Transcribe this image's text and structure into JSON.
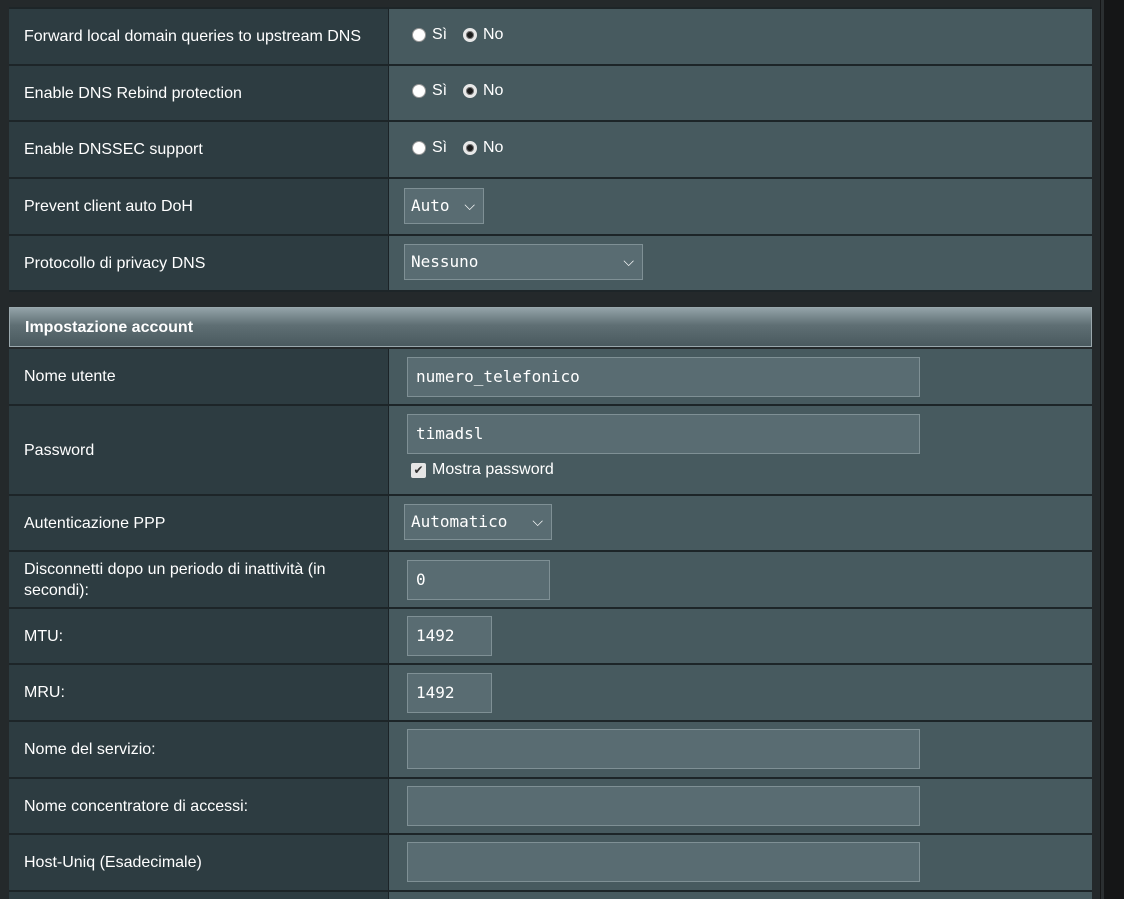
{
  "dns": {
    "forward_local": {
      "label": "Forward local domain queries to upstream DNS",
      "yes": "Sì",
      "no": "No",
      "selected": "No"
    },
    "rebind": {
      "label": "Enable DNS Rebind protection",
      "yes": "Sì",
      "no": "No",
      "selected": "No"
    },
    "dnssec": {
      "label": "Enable DNSSEC support",
      "yes": "Sì",
      "no": "No",
      "selected": "No"
    },
    "doh": {
      "label": "Prevent client auto DoH",
      "value": "Auto"
    },
    "privacy": {
      "label": "Protocollo di privacy DNS",
      "value": "Nessuno"
    }
  },
  "account": {
    "title": "Impostazione account",
    "username": {
      "label": "Nome utente",
      "value": "numero_telefonico"
    },
    "password": {
      "label": "Password",
      "value": "timadsl",
      "show_label": "Mostra password",
      "show_checked": true
    },
    "ppp_auth": {
      "label": "Autenticazione PPP",
      "value": "Automatico"
    },
    "idle": {
      "label": "Disconnetti dopo un periodo di inattività (in secondi):",
      "value": "0"
    },
    "mtu": {
      "label": "MTU:",
      "value": "1492"
    },
    "mru": {
      "label": "MRU:",
      "value": "1492"
    },
    "service": {
      "label": "Nome del servizio:",
      "value": ""
    },
    "concentrator": {
      "label": "Nome concentratore di accessi:",
      "value": ""
    },
    "hostuniq": {
      "label": "Host-Uniq (Esadecimale)",
      "value": ""
    }
  },
  "colors": {
    "label_bg": "#2d3c41",
    "value_bg": "#475a5f",
    "input_bg": "#596c72"
  }
}
